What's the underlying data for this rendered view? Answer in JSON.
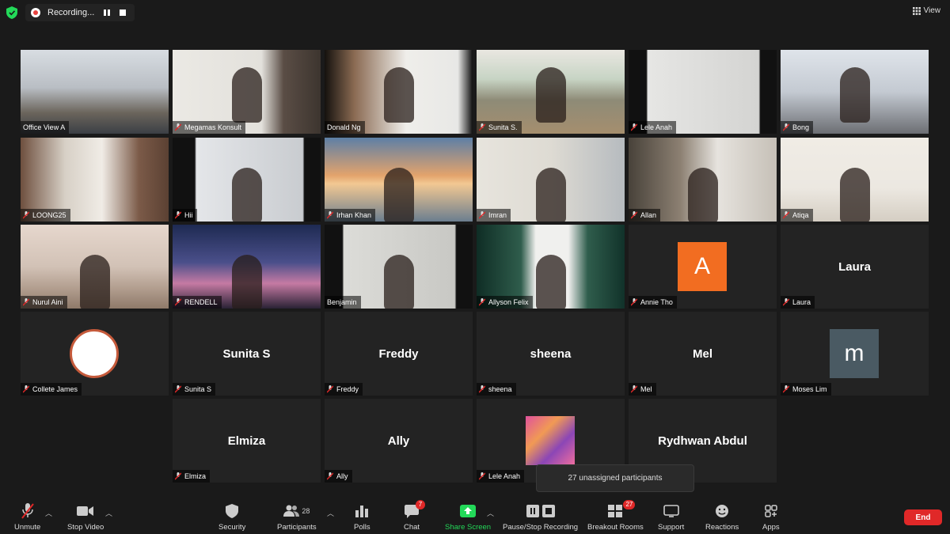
{
  "recording": {
    "label": "Recording..."
  },
  "view": {
    "label": "View"
  },
  "tiles": [
    {
      "name": "Office View A",
      "bigname": "",
      "avatar": ""
    },
    {
      "name": "Megamas Konsult",
      "bigname": "",
      "avatar": ""
    },
    {
      "name": "Donald Ng",
      "bigname": "",
      "avatar": ""
    },
    {
      "name": "Sunita S.",
      "bigname": "",
      "avatar": ""
    },
    {
      "name": "Lele Anah",
      "bigname": "",
      "avatar": ""
    },
    {
      "name": "Bong",
      "bigname": "",
      "avatar": ""
    },
    {
      "name": "LOONG25",
      "bigname": "",
      "avatar": ""
    },
    {
      "name": "Hii",
      "bigname": "",
      "avatar": ""
    },
    {
      "name": "Irhan Khan",
      "bigname": "",
      "avatar": ""
    },
    {
      "name": "Imran",
      "bigname": "",
      "avatar": ""
    },
    {
      "name": "Allan",
      "bigname": "",
      "avatar": ""
    },
    {
      "name": "Atiqa",
      "bigname": "",
      "avatar": ""
    },
    {
      "name": "Nurul Aini",
      "bigname": "",
      "avatar": ""
    },
    {
      "name": "RENDELL",
      "bigname": "",
      "avatar": ""
    },
    {
      "name": "Benjamin",
      "bigname": "",
      "avatar": ""
    },
    {
      "name": "Allyson Felix",
      "bigname": "",
      "avatar": ""
    },
    {
      "name": "Annie Tho",
      "bigname": "",
      "avatar": "A"
    },
    {
      "name": "Laura",
      "bigname": "Laura",
      "avatar": ""
    },
    {
      "name": "Collete James",
      "bigname": "",
      "avatar": ""
    },
    {
      "name": "Sunita S",
      "bigname": "Sunita S",
      "avatar": ""
    },
    {
      "name": "Freddy",
      "bigname": "Freddy",
      "avatar": ""
    },
    {
      "name": "sheena",
      "bigname": "sheena",
      "avatar": ""
    },
    {
      "name": "Mel",
      "bigname": "Mel",
      "avatar": ""
    },
    {
      "name": "Moses Lim",
      "bigname": "",
      "avatar": "m"
    },
    {
      "name": "Elmiza",
      "bigname": "Elmiza",
      "avatar": ""
    },
    {
      "name": "Ally",
      "bigname": "Ally",
      "avatar": ""
    },
    {
      "name": "Lele Anah",
      "bigname": "",
      "avatar": ""
    },
    {
      "name": "Rydhwan Abdul",
      "bigname": "Rydhwan Abdul",
      "avatar": ""
    }
  ],
  "avatar_colors": {
    "Annie Tho": "#f26d21",
    "Moses Lim": "#4a5a63"
  },
  "tooltip": {
    "text": "27 unassigned participants"
  },
  "toolbar": {
    "unmute": "Unmute",
    "stop_video": "Stop Video",
    "security": "Security",
    "participants": "Participants",
    "participants_count": "28",
    "polls": "Polls",
    "chat": "Chat",
    "chat_badge": "7",
    "share_screen": "Share Screen",
    "pause_stop_recording": "Pause/Stop Recording",
    "breakout_rooms": "Breakout Rooms",
    "breakout_badge": "27",
    "support": "Support",
    "reactions": "Reactions",
    "apps": "Apps",
    "end": "End"
  },
  "colors": {
    "accent_green": "#23d959",
    "end_red": "#e02828",
    "active_speaker": "#e5f070"
  }
}
